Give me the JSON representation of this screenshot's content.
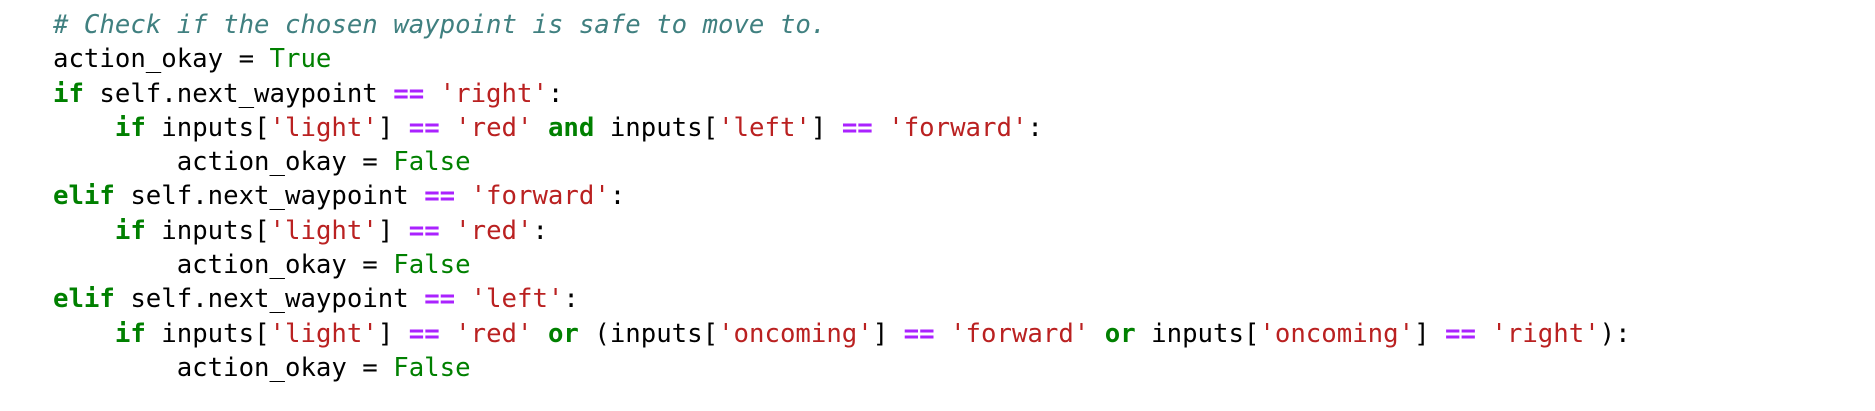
{
  "colors": {
    "background": "#ffffff",
    "comment": "#408080",
    "keyword": "#008000",
    "operator": "#aa22ff",
    "string": "#ba2121",
    "text": "#000000"
  },
  "code_lines": [
    {
      "tokens": [
        {
          "t": "comment",
          "v": "# Check if the chosen waypoint is safe to move to."
        }
      ]
    },
    {
      "tokens": [
        {
          "t": "text",
          "v": "action_okay = "
        },
        {
          "t": "const",
          "v": "True"
        }
      ]
    },
    {
      "tokens": [
        {
          "t": "keyword",
          "v": "if"
        },
        {
          "t": "text",
          "v": " self.next_waypoint "
        },
        {
          "t": "op",
          "v": "=="
        },
        {
          "t": "text",
          "v": " "
        },
        {
          "t": "str",
          "v": "'right'"
        },
        {
          "t": "text",
          "v": ":"
        }
      ]
    },
    {
      "tokens": [
        {
          "t": "text",
          "v": "    "
        },
        {
          "t": "keyword",
          "v": "if"
        },
        {
          "t": "text",
          "v": " inputs["
        },
        {
          "t": "str",
          "v": "'light'"
        },
        {
          "t": "text",
          "v": "] "
        },
        {
          "t": "op",
          "v": "=="
        },
        {
          "t": "text",
          "v": " "
        },
        {
          "t": "str",
          "v": "'red'"
        },
        {
          "t": "text",
          "v": " "
        },
        {
          "t": "keyword",
          "v": "and"
        },
        {
          "t": "text",
          "v": " inputs["
        },
        {
          "t": "str",
          "v": "'left'"
        },
        {
          "t": "text",
          "v": "] "
        },
        {
          "t": "op",
          "v": "=="
        },
        {
          "t": "text",
          "v": " "
        },
        {
          "t": "str",
          "v": "'forward'"
        },
        {
          "t": "text",
          "v": ":"
        }
      ]
    },
    {
      "tokens": [
        {
          "t": "text",
          "v": "        action_okay = "
        },
        {
          "t": "const",
          "v": "False"
        }
      ]
    },
    {
      "tokens": [
        {
          "t": "keyword",
          "v": "elif"
        },
        {
          "t": "text",
          "v": " self.next_waypoint "
        },
        {
          "t": "op",
          "v": "=="
        },
        {
          "t": "text",
          "v": " "
        },
        {
          "t": "str",
          "v": "'forward'"
        },
        {
          "t": "text",
          "v": ":"
        }
      ]
    },
    {
      "tokens": [
        {
          "t": "text",
          "v": "    "
        },
        {
          "t": "keyword",
          "v": "if"
        },
        {
          "t": "text",
          "v": " inputs["
        },
        {
          "t": "str",
          "v": "'light'"
        },
        {
          "t": "text",
          "v": "] "
        },
        {
          "t": "op",
          "v": "=="
        },
        {
          "t": "text",
          "v": " "
        },
        {
          "t": "str",
          "v": "'red'"
        },
        {
          "t": "text",
          "v": ":"
        }
      ]
    },
    {
      "tokens": [
        {
          "t": "text",
          "v": "        action_okay = "
        },
        {
          "t": "const",
          "v": "False"
        }
      ]
    },
    {
      "tokens": [
        {
          "t": "keyword",
          "v": "elif"
        },
        {
          "t": "text",
          "v": " self.next_waypoint "
        },
        {
          "t": "op",
          "v": "=="
        },
        {
          "t": "text",
          "v": " "
        },
        {
          "t": "str",
          "v": "'left'"
        },
        {
          "t": "text",
          "v": ":"
        }
      ]
    },
    {
      "tokens": [
        {
          "t": "text",
          "v": "    "
        },
        {
          "t": "keyword",
          "v": "if"
        },
        {
          "t": "text",
          "v": " inputs["
        },
        {
          "t": "str",
          "v": "'light'"
        },
        {
          "t": "text",
          "v": "] "
        },
        {
          "t": "op",
          "v": "=="
        },
        {
          "t": "text",
          "v": " "
        },
        {
          "t": "str",
          "v": "'red'"
        },
        {
          "t": "text",
          "v": " "
        },
        {
          "t": "keyword",
          "v": "or"
        },
        {
          "t": "text",
          "v": " (inputs["
        },
        {
          "t": "str",
          "v": "'oncoming'"
        },
        {
          "t": "text",
          "v": "] "
        },
        {
          "t": "op",
          "v": "=="
        },
        {
          "t": "text",
          "v": " "
        },
        {
          "t": "str",
          "v": "'forward'"
        },
        {
          "t": "text",
          "v": " "
        },
        {
          "t": "keyword",
          "v": "or"
        },
        {
          "t": "text",
          "v": " inputs["
        },
        {
          "t": "str",
          "v": "'oncoming'"
        },
        {
          "t": "text",
          "v": "] "
        },
        {
          "t": "op",
          "v": "=="
        },
        {
          "t": "text",
          "v": " "
        },
        {
          "t": "str",
          "v": "'right'"
        },
        {
          "t": "text",
          "v": "):"
        }
      ]
    },
    {
      "tokens": [
        {
          "t": "text",
          "v": "        action_okay = "
        },
        {
          "t": "const",
          "v": "False"
        }
      ]
    }
  ]
}
